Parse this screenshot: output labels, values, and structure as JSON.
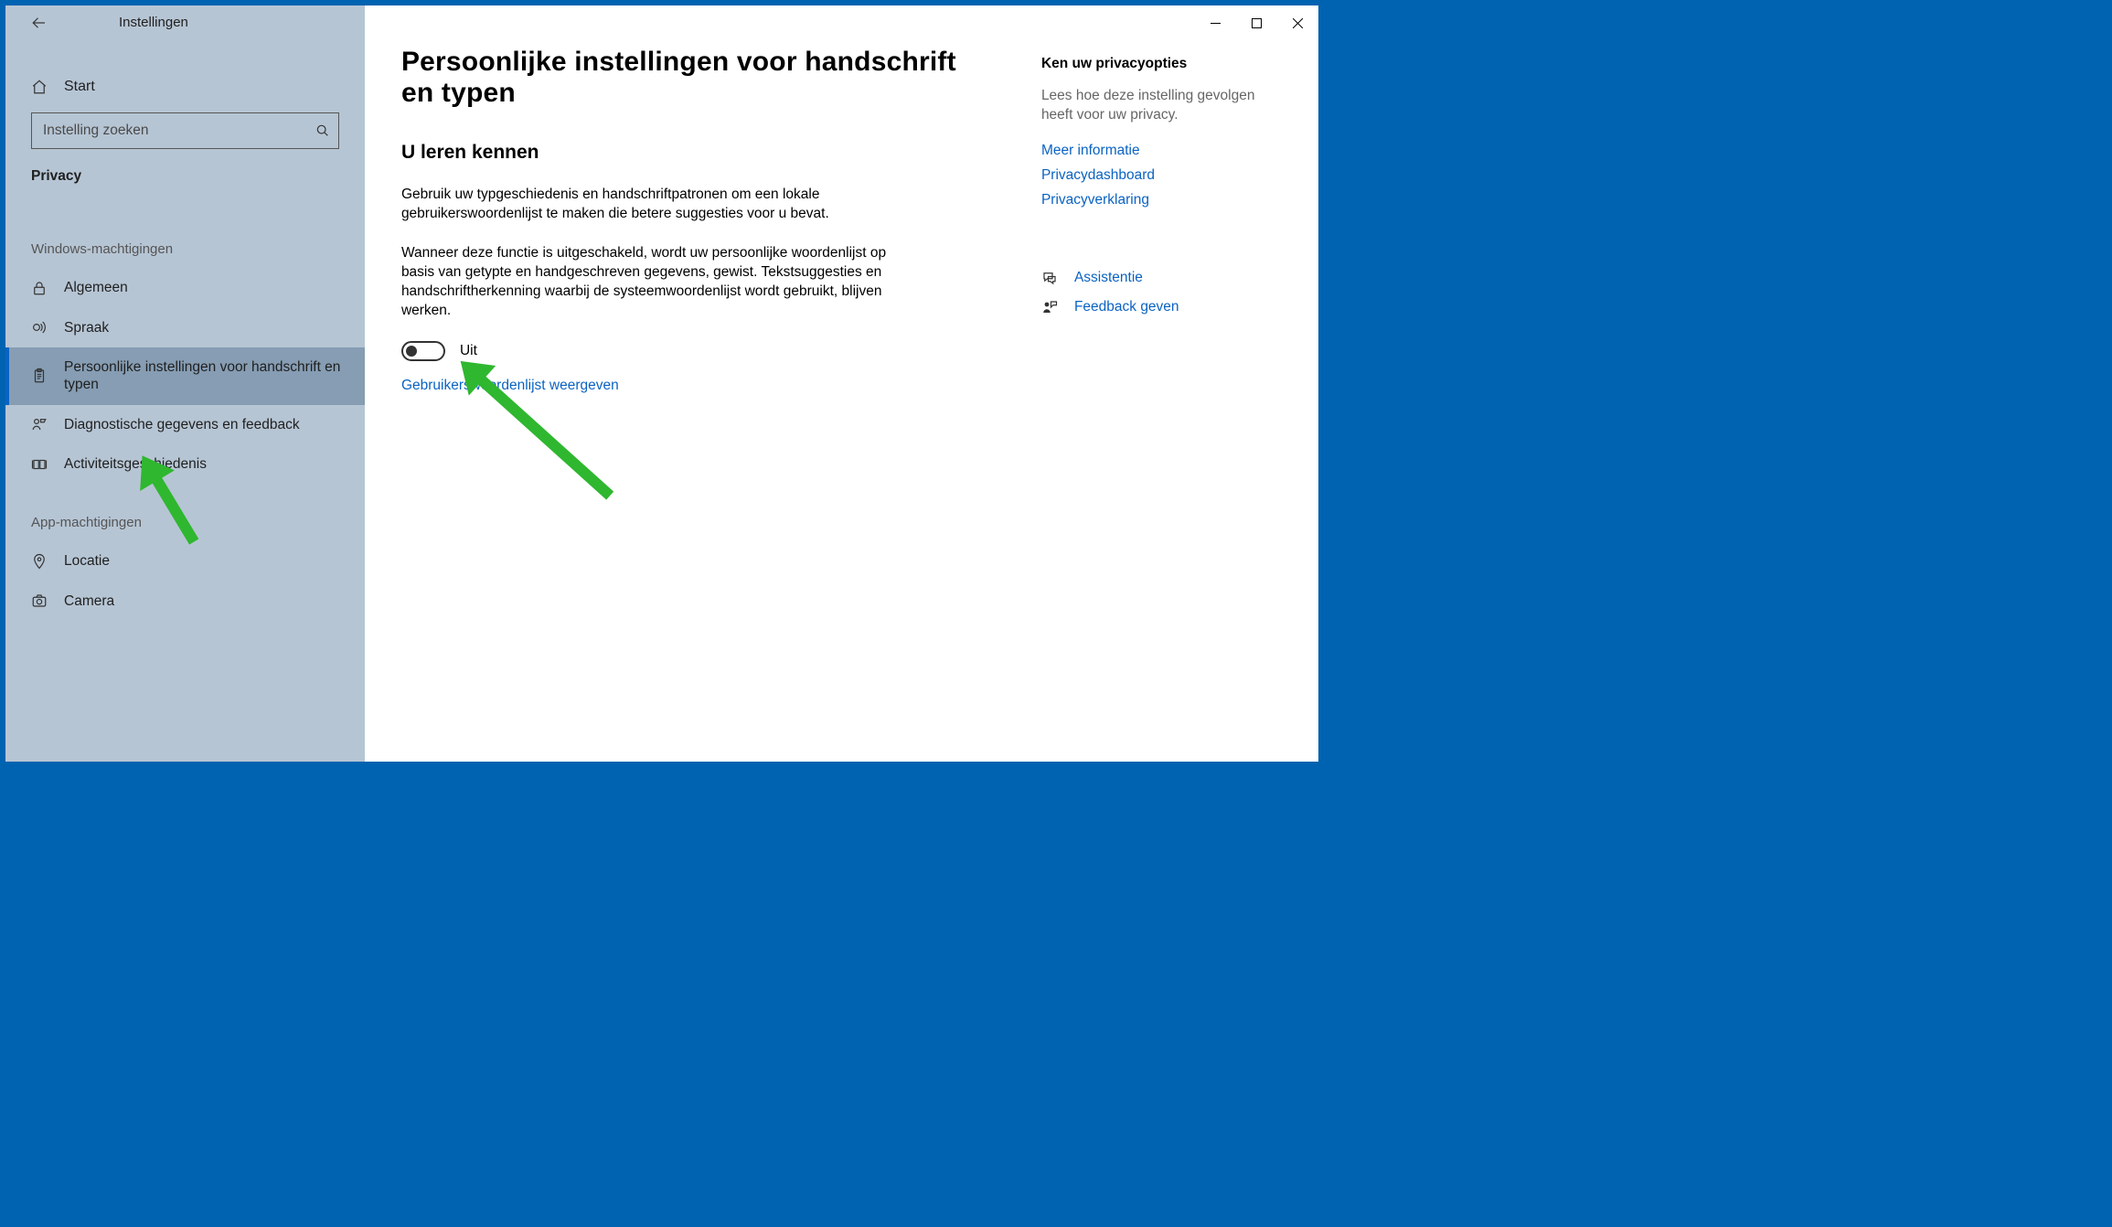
{
  "window": {
    "app_title": "Instellingen"
  },
  "sidebar": {
    "home_label": "Start",
    "search_placeholder": "Instelling zoeken",
    "category": "Privacy",
    "group1": "Windows-machtigingen",
    "group2": "App-machtigingen",
    "items_win": [
      {
        "label": "Algemeen",
        "icon": "lock"
      },
      {
        "label": "Spraak",
        "icon": "speech"
      },
      {
        "label": "Persoonlijke instellingen voor handschrift en typen",
        "icon": "clipboard",
        "selected": true
      },
      {
        "label": "Diagnostische gegevens en feedback",
        "icon": "feedback"
      },
      {
        "label": "Activiteitsgeschiedenis",
        "icon": "history"
      }
    ],
    "items_app": [
      {
        "label": "Locatie",
        "icon": "location"
      },
      {
        "label": "Camera",
        "icon": "camera"
      }
    ]
  },
  "main": {
    "title": "Persoonlijke instellingen voor handschrift en typen",
    "section_title": "U leren kennen",
    "p1": "Gebruik uw typgeschiedenis en handschriftpatronen om een lokale gebruikerswoordenlijst te maken die betere suggesties voor u bevat.",
    "p2": "Wanneer deze functie is uitgeschakeld, wordt uw persoonlijke woordenlijst op basis van getypte en handgeschreven gegevens, gewist. Tekstsuggesties en handschriftherkenning waarbij de systeemwoordenlijst wordt gebruikt, blijven werken.",
    "toggle_state": "Uit",
    "dict_link": "Gebruikerswoordenlijst weergeven"
  },
  "right": {
    "heading": "Ken uw privacyopties",
    "desc": "Lees hoe deze instelling gevolgen heeft voor uw privacy.",
    "links": [
      "Meer informatie",
      "Privacydashboard",
      "Privacyverklaring"
    ],
    "help": [
      {
        "label": "Assistentie",
        "icon": "chat"
      },
      {
        "label": "Feedback geven",
        "icon": "person-feedback"
      }
    ]
  }
}
